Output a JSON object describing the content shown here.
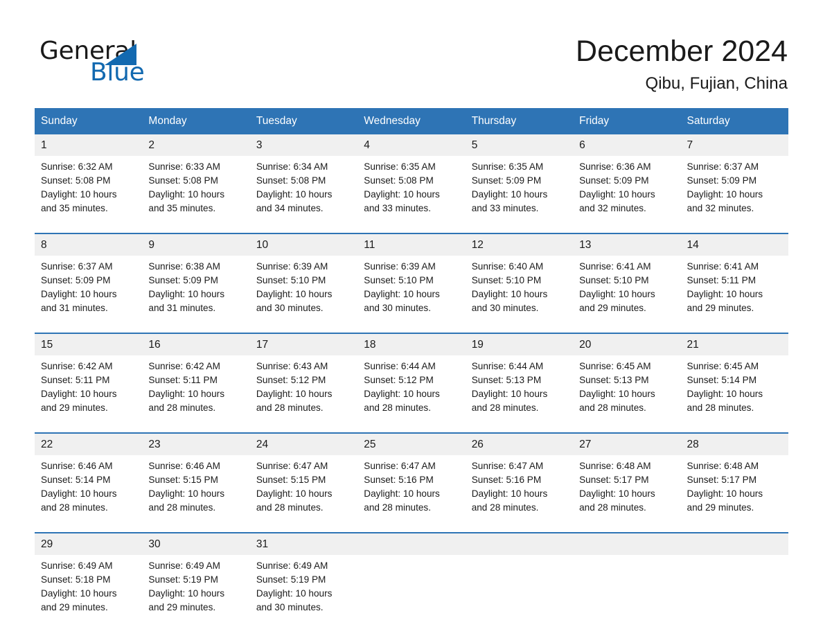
{
  "brand": {
    "name_part1": "General",
    "name_part2": "Blue",
    "accent_color": "#1269b0"
  },
  "header": {
    "title": "December 2024",
    "subtitle": "Qibu, Fujian, China"
  },
  "theme": {
    "header_bg": "#2e74b5",
    "daynum_bg": "#f0f0f0",
    "cell_bg": "#ffffff",
    "text_color": "#1a1a1a",
    "header_text_color": "#ffffff"
  },
  "weekdays": [
    "Sunday",
    "Monday",
    "Tuesday",
    "Wednesday",
    "Thursday",
    "Friday",
    "Saturday"
  ],
  "weeks": [
    {
      "days": [
        {
          "num": "1",
          "sunrise": "Sunrise: 6:32 AM",
          "sunset": "Sunset: 5:08 PM",
          "daylight1": "Daylight: 10 hours",
          "daylight2": "and 35 minutes."
        },
        {
          "num": "2",
          "sunrise": "Sunrise: 6:33 AM",
          "sunset": "Sunset: 5:08 PM",
          "daylight1": "Daylight: 10 hours",
          "daylight2": "and 35 minutes."
        },
        {
          "num": "3",
          "sunrise": "Sunrise: 6:34 AM",
          "sunset": "Sunset: 5:08 PM",
          "daylight1": "Daylight: 10 hours",
          "daylight2": "and 34 minutes."
        },
        {
          "num": "4",
          "sunrise": "Sunrise: 6:35 AM",
          "sunset": "Sunset: 5:08 PM",
          "daylight1": "Daylight: 10 hours",
          "daylight2": "and 33 minutes."
        },
        {
          "num": "5",
          "sunrise": "Sunrise: 6:35 AM",
          "sunset": "Sunset: 5:09 PM",
          "daylight1": "Daylight: 10 hours",
          "daylight2": "and 33 minutes."
        },
        {
          "num": "6",
          "sunrise": "Sunrise: 6:36 AM",
          "sunset": "Sunset: 5:09 PM",
          "daylight1": "Daylight: 10 hours",
          "daylight2": "and 32 minutes."
        },
        {
          "num": "7",
          "sunrise": "Sunrise: 6:37 AM",
          "sunset": "Sunset: 5:09 PM",
          "daylight1": "Daylight: 10 hours",
          "daylight2": "and 32 minutes."
        }
      ]
    },
    {
      "days": [
        {
          "num": "8",
          "sunrise": "Sunrise: 6:37 AM",
          "sunset": "Sunset: 5:09 PM",
          "daylight1": "Daylight: 10 hours",
          "daylight2": "and 31 minutes."
        },
        {
          "num": "9",
          "sunrise": "Sunrise: 6:38 AM",
          "sunset": "Sunset: 5:09 PM",
          "daylight1": "Daylight: 10 hours",
          "daylight2": "and 31 minutes."
        },
        {
          "num": "10",
          "sunrise": "Sunrise: 6:39 AM",
          "sunset": "Sunset: 5:10 PM",
          "daylight1": "Daylight: 10 hours",
          "daylight2": "and 30 minutes."
        },
        {
          "num": "11",
          "sunrise": "Sunrise: 6:39 AM",
          "sunset": "Sunset: 5:10 PM",
          "daylight1": "Daylight: 10 hours",
          "daylight2": "and 30 minutes."
        },
        {
          "num": "12",
          "sunrise": "Sunrise: 6:40 AM",
          "sunset": "Sunset: 5:10 PM",
          "daylight1": "Daylight: 10 hours",
          "daylight2": "and 30 minutes."
        },
        {
          "num": "13",
          "sunrise": "Sunrise: 6:41 AM",
          "sunset": "Sunset: 5:10 PM",
          "daylight1": "Daylight: 10 hours",
          "daylight2": "and 29 minutes."
        },
        {
          "num": "14",
          "sunrise": "Sunrise: 6:41 AM",
          "sunset": "Sunset: 5:11 PM",
          "daylight1": "Daylight: 10 hours",
          "daylight2": "and 29 minutes."
        }
      ]
    },
    {
      "days": [
        {
          "num": "15",
          "sunrise": "Sunrise: 6:42 AM",
          "sunset": "Sunset: 5:11 PM",
          "daylight1": "Daylight: 10 hours",
          "daylight2": "and 29 minutes."
        },
        {
          "num": "16",
          "sunrise": "Sunrise: 6:42 AM",
          "sunset": "Sunset: 5:11 PM",
          "daylight1": "Daylight: 10 hours",
          "daylight2": "and 28 minutes."
        },
        {
          "num": "17",
          "sunrise": "Sunrise: 6:43 AM",
          "sunset": "Sunset: 5:12 PM",
          "daylight1": "Daylight: 10 hours",
          "daylight2": "and 28 minutes."
        },
        {
          "num": "18",
          "sunrise": "Sunrise: 6:44 AM",
          "sunset": "Sunset: 5:12 PM",
          "daylight1": "Daylight: 10 hours",
          "daylight2": "and 28 minutes."
        },
        {
          "num": "19",
          "sunrise": "Sunrise: 6:44 AM",
          "sunset": "Sunset: 5:13 PM",
          "daylight1": "Daylight: 10 hours",
          "daylight2": "and 28 minutes."
        },
        {
          "num": "20",
          "sunrise": "Sunrise: 6:45 AM",
          "sunset": "Sunset: 5:13 PM",
          "daylight1": "Daylight: 10 hours",
          "daylight2": "and 28 minutes."
        },
        {
          "num": "21",
          "sunrise": "Sunrise: 6:45 AM",
          "sunset": "Sunset: 5:14 PM",
          "daylight1": "Daylight: 10 hours",
          "daylight2": "and 28 minutes."
        }
      ]
    },
    {
      "days": [
        {
          "num": "22",
          "sunrise": "Sunrise: 6:46 AM",
          "sunset": "Sunset: 5:14 PM",
          "daylight1": "Daylight: 10 hours",
          "daylight2": "and 28 minutes."
        },
        {
          "num": "23",
          "sunrise": "Sunrise: 6:46 AM",
          "sunset": "Sunset: 5:15 PM",
          "daylight1": "Daylight: 10 hours",
          "daylight2": "and 28 minutes."
        },
        {
          "num": "24",
          "sunrise": "Sunrise: 6:47 AM",
          "sunset": "Sunset: 5:15 PM",
          "daylight1": "Daylight: 10 hours",
          "daylight2": "and 28 minutes."
        },
        {
          "num": "25",
          "sunrise": "Sunrise: 6:47 AM",
          "sunset": "Sunset: 5:16 PM",
          "daylight1": "Daylight: 10 hours",
          "daylight2": "and 28 minutes."
        },
        {
          "num": "26",
          "sunrise": "Sunrise: 6:47 AM",
          "sunset": "Sunset: 5:16 PM",
          "daylight1": "Daylight: 10 hours",
          "daylight2": "and 28 minutes."
        },
        {
          "num": "27",
          "sunrise": "Sunrise: 6:48 AM",
          "sunset": "Sunset: 5:17 PM",
          "daylight1": "Daylight: 10 hours",
          "daylight2": "and 28 minutes."
        },
        {
          "num": "28",
          "sunrise": "Sunrise: 6:48 AM",
          "sunset": "Sunset: 5:17 PM",
          "daylight1": "Daylight: 10 hours",
          "daylight2": "and 29 minutes."
        }
      ]
    },
    {
      "days": [
        {
          "num": "29",
          "sunrise": "Sunrise: 6:49 AM",
          "sunset": "Sunset: 5:18 PM",
          "daylight1": "Daylight: 10 hours",
          "daylight2": "and 29 minutes."
        },
        {
          "num": "30",
          "sunrise": "Sunrise: 6:49 AM",
          "sunset": "Sunset: 5:19 PM",
          "daylight1": "Daylight: 10 hours",
          "daylight2": "and 29 minutes."
        },
        {
          "num": "31",
          "sunrise": "Sunrise: 6:49 AM",
          "sunset": "Sunset: 5:19 PM",
          "daylight1": "Daylight: 10 hours",
          "daylight2": "and 30 minutes."
        },
        {
          "num": "",
          "sunrise": "",
          "sunset": "",
          "daylight1": "",
          "daylight2": ""
        },
        {
          "num": "",
          "sunrise": "",
          "sunset": "",
          "daylight1": "",
          "daylight2": ""
        },
        {
          "num": "",
          "sunrise": "",
          "sunset": "",
          "daylight1": "",
          "daylight2": ""
        },
        {
          "num": "",
          "sunrise": "",
          "sunset": "",
          "daylight1": "",
          "daylight2": ""
        }
      ]
    }
  ]
}
